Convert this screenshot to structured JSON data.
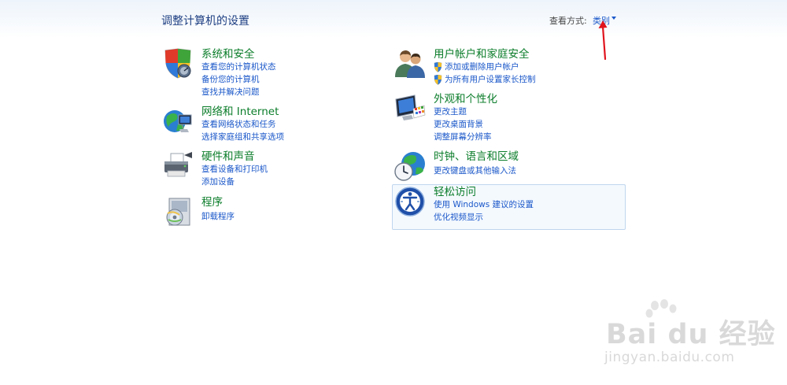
{
  "header": {
    "title": "调整计算机的设置",
    "view_by_label": "查看方式:",
    "view_by_value": "类别"
  },
  "categories": [
    {
      "title": "系统和安全",
      "links": [
        "查看您的计算机状态",
        "备份您的计算机",
        "查找并解决问题"
      ]
    },
    {
      "title": "网络和 Internet",
      "links": [
        "查看网络状态和任务",
        "选择家庭组和共享选项"
      ]
    },
    {
      "title": "硬件和声音",
      "links": [
        "查看设备和打印机",
        "添加设备"
      ]
    },
    {
      "title": "程序",
      "links": [
        "卸载程序"
      ]
    },
    {
      "title": "用户帐户和家庭安全",
      "links": [
        "添加或删除用户帐户",
        "为所有用户设置家长控制"
      ]
    },
    {
      "title": "外观和个性化",
      "links": [
        "更改主题",
        "更改桌面背景",
        "调整屏幕分辨率"
      ]
    },
    {
      "title": "时钟、语言和区域",
      "links": [
        "更改键盘或其他输入法"
      ]
    },
    {
      "title": "轻松访问",
      "links": [
        "使用 Windows 建议的设置",
        "优化视频显示"
      ]
    }
  ],
  "watermark": {
    "brand": "Bai du 经验",
    "url": "jingyan.baidu.com"
  },
  "colors": {
    "category_title": "#0b7d2a",
    "link": "#1a57c9",
    "page_title": "#1e3f82",
    "annotation_arrow": "#e0141e"
  }
}
